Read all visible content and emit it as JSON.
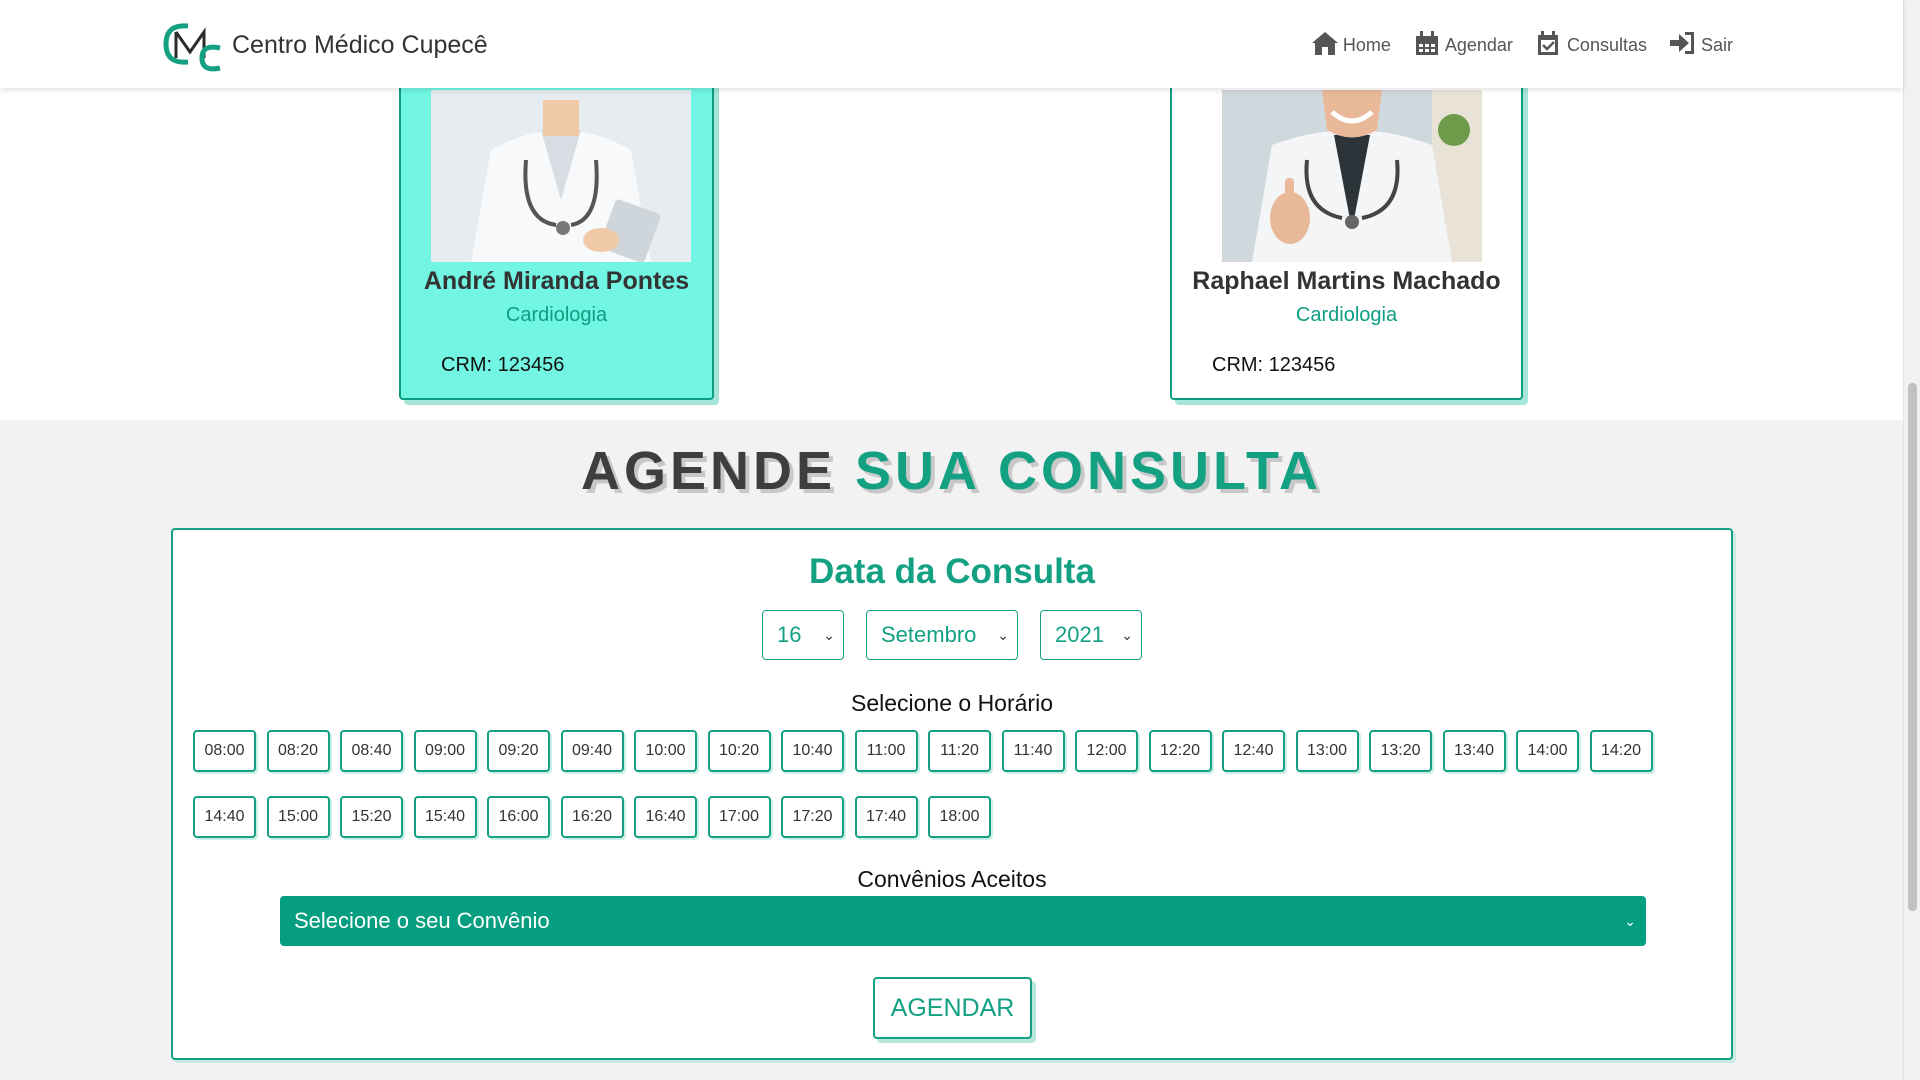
{
  "brand": {
    "name": "Centro Médico Cupecê",
    "logo_text": "CMC"
  },
  "nav": [
    {
      "label": "Home",
      "icon": "home-icon"
    },
    {
      "label": "Agendar",
      "icon": "calendar-icon"
    },
    {
      "label": "Consultas",
      "icon": "calendar-check-icon"
    },
    {
      "label": "Sair",
      "icon": "sign-in-icon"
    }
  ],
  "doctors": [
    {
      "name": "André Miranda Pontes",
      "specialty": "Cardiologia",
      "crm": "CRM: 123456",
      "selected": true
    },
    {
      "name": "Raphael Martins Machado",
      "specialty": "Cardiologia",
      "crm": "CRM: 123456",
      "selected": false
    }
  ],
  "schedule": {
    "title_part1": "AGENDE",
    "title_part2": "SUA CONSULTA",
    "date_title": "Data da Consulta",
    "day": "16",
    "month": "Setembro",
    "year": "2021",
    "time_label": "Selecione o Horário",
    "times": [
      "08:00",
      "08:20",
      "08:40",
      "09:00",
      "09:20",
      "09:40",
      "10:00",
      "10:20",
      "10:40",
      "11:00",
      "11:20",
      "11:40",
      "12:00",
      "12:20",
      "12:40",
      "13:00",
      "13:20",
      "13:40",
      "14:00",
      "14:20",
      "14:40",
      "15:00",
      "15:20",
      "15:40",
      "16:00",
      "16:20",
      "16:40",
      "17:00",
      "17:20",
      "17:40",
      "18:00"
    ],
    "convenio_label": "Convênios Aceitos",
    "convenio_placeholder": "Selecione o seu Convênio",
    "submit_label": "AGENDAR"
  },
  "colors": {
    "accent": "#13a083",
    "selected_card": "#72f5e3",
    "convenio_bg": "#069e80"
  }
}
